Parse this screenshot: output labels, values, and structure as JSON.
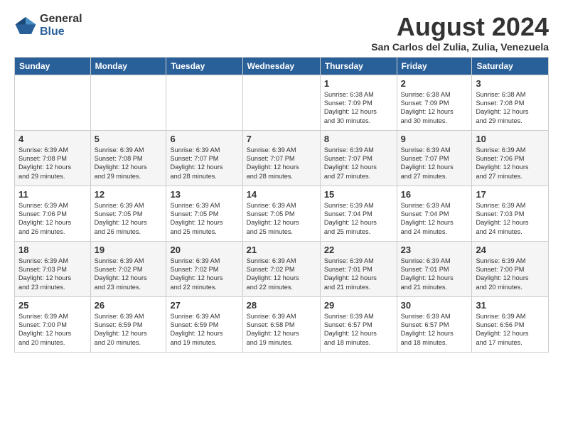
{
  "logo": {
    "general": "General",
    "blue": "Blue"
  },
  "title": "August 2024",
  "location": "San Carlos del Zulia, Zulia, Venezuela",
  "days_header": [
    "Sunday",
    "Monday",
    "Tuesday",
    "Wednesday",
    "Thursday",
    "Friday",
    "Saturday"
  ],
  "weeks": [
    [
      {
        "day": "",
        "info": ""
      },
      {
        "day": "",
        "info": ""
      },
      {
        "day": "",
        "info": ""
      },
      {
        "day": "",
        "info": ""
      },
      {
        "day": "1",
        "info": "Sunrise: 6:38 AM\nSunset: 7:09 PM\nDaylight: 12 hours\nand 30 minutes."
      },
      {
        "day": "2",
        "info": "Sunrise: 6:38 AM\nSunset: 7:09 PM\nDaylight: 12 hours\nand 30 minutes."
      },
      {
        "day": "3",
        "info": "Sunrise: 6:38 AM\nSunset: 7:08 PM\nDaylight: 12 hours\nand 29 minutes."
      }
    ],
    [
      {
        "day": "4",
        "info": "Sunrise: 6:39 AM\nSunset: 7:08 PM\nDaylight: 12 hours\nand 29 minutes."
      },
      {
        "day": "5",
        "info": "Sunrise: 6:39 AM\nSunset: 7:08 PM\nDaylight: 12 hours\nand 29 minutes."
      },
      {
        "day": "6",
        "info": "Sunrise: 6:39 AM\nSunset: 7:07 PM\nDaylight: 12 hours\nand 28 minutes."
      },
      {
        "day": "7",
        "info": "Sunrise: 6:39 AM\nSunset: 7:07 PM\nDaylight: 12 hours\nand 28 minutes."
      },
      {
        "day": "8",
        "info": "Sunrise: 6:39 AM\nSunset: 7:07 PM\nDaylight: 12 hours\nand 27 minutes."
      },
      {
        "day": "9",
        "info": "Sunrise: 6:39 AM\nSunset: 7:07 PM\nDaylight: 12 hours\nand 27 minutes."
      },
      {
        "day": "10",
        "info": "Sunrise: 6:39 AM\nSunset: 7:06 PM\nDaylight: 12 hours\nand 27 minutes."
      }
    ],
    [
      {
        "day": "11",
        "info": "Sunrise: 6:39 AM\nSunset: 7:06 PM\nDaylight: 12 hours\nand 26 minutes."
      },
      {
        "day": "12",
        "info": "Sunrise: 6:39 AM\nSunset: 7:05 PM\nDaylight: 12 hours\nand 26 minutes."
      },
      {
        "day": "13",
        "info": "Sunrise: 6:39 AM\nSunset: 7:05 PM\nDaylight: 12 hours\nand 25 minutes."
      },
      {
        "day": "14",
        "info": "Sunrise: 6:39 AM\nSunset: 7:05 PM\nDaylight: 12 hours\nand 25 minutes."
      },
      {
        "day": "15",
        "info": "Sunrise: 6:39 AM\nSunset: 7:04 PM\nDaylight: 12 hours\nand 25 minutes."
      },
      {
        "day": "16",
        "info": "Sunrise: 6:39 AM\nSunset: 7:04 PM\nDaylight: 12 hours\nand 24 minutes."
      },
      {
        "day": "17",
        "info": "Sunrise: 6:39 AM\nSunset: 7:03 PM\nDaylight: 12 hours\nand 24 minutes."
      }
    ],
    [
      {
        "day": "18",
        "info": "Sunrise: 6:39 AM\nSunset: 7:03 PM\nDaylight: 12 hours\nand 23 minutes."
      },
      {
        "day": "19",
        "info": "Sunrise: 6:39 AM\nSunset: 7:02 PM\nDaylight: 12 hours\nand 23 minutes."
      },
      {
        "day": "20",
        "info": "Sunrise: 6:39 AM\nSunset: 7:02 PM\nDaylight: 12 hours\nand 22 minutes."
      },
      {
        "day": "21",
        "info": "Sunrise: 6:39 AM\nSunset: 7:02 PM\nDaylight: 12 hours\nand 22 minutes."
      },
      {
        "day": "22",
        "info": "Sunrise: 6:39 AM\nSunset: 7:01 PM\nDaylight: 12 hours\nand 21 minutes."
      },
      {
        "day": "23",
        "info": "Sunrise: 6:39 AM\nSunset: 7:01 PM\nDaylight: 12 hours\nand 21 minutes."
      },
      {
        "day": "24",
        "info": "Sunrise: 6:39 AM\nSunset: 7:00 PM\nDaylight: 12 hours\nand 20 minutes."
      }
    ],
    [
      {
        "day": "25",
        "info": "Sunrise: 6:39 AM\nSunset: 7:00 PM\nDaylight: 12 hours\nand 20 minutes."
      },
      {
        "day": "26",
        "info": "Sunrise: 6:39 AM\nSunset: 6:59 PM\nDaylight: 12 hours\nand 20 minutes."
      },
      {
        "day": "27",
        "info": "Sunrise: 6:39 AM\nSunset: 6:59 PM\nDaylight: 12 hours\nand 19 minutes."
      },
      {
        "day": "28",
        "info": "Sunrise: 6:39 AM\nSunset: 6:58 PM\nDaylight: 12 hours\nand 19 minutes."
      },
      {
        "day": "29",
        "info": "Sunrise: 6:39 AM\nSunset: 6:57 PM\nDaylight: 12 hours\nand 18 minutes."
      },
      {
        "day": "30",
        "info": "Sunrise: 6:39 AM\nSunset: 6:57 PM\nDaylight: 12 hours\nand 18 minutes."
      },
      {
        "day": "31",
        "info": "Sunrise: 6:39 AM\nSunset: 6:56 PM\nDaylight: 12 hours\nand 17 minutes."
      }
    ]
  ]
}
